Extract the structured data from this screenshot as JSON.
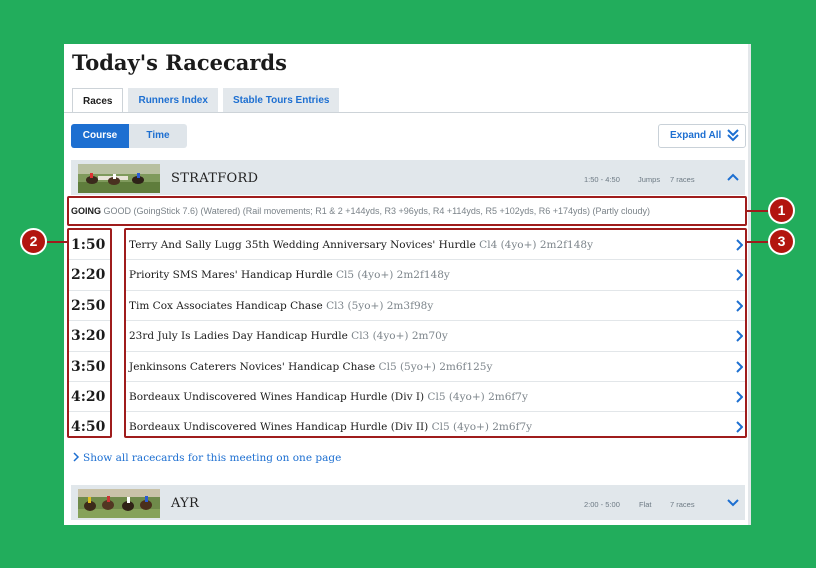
{
  "page": {
    "title": "Today's Racecards",
    "tabs": [
      {
        "label": "Races",
        "active": true
      },
      {
        "label": "Runners Index",
        "active": false
      },
      {
        "label": "Stable Tours Entries",
        "active": false
      }
    ],
    "view_toggle": [
      {
        "label": "Course",
        "active": true
      },
      {
        "label": "Time",
        "active": false
      }
    ],
    "expand_all": "Expand All",
    "show_all_link": "Show all racecards for this meeting on one page"
  },
  "meetings": [
    {
      "name": "STRATFORD",
      "time_range": "1:50 - 4:50",
      "race_type": "Jumps",
      "race_count": "7 races",
      "expanded": true,
      "going_label": "GOING",
      "going_text": "GOOD (GoingStick 7.6) (Watered) (Rail movements; R1 & 2 +144yds, R3 +96yds, R4 +114yds, R5 +102yds, R6 +174yds) (Partly cloudy)",
      "races": [
        {
          "time": "1:50",
          "name": "Terry And Sally Lugg 35th Wedding Anniversary Novices' Hurdle",
          "details": "Cl4 (4yo+) 2m2f148y"
        },
        {
          "time": "2:20",
          "name": "Priority SMS Mares' Handicap Hurdle",
          "details": "Cl5 (4yo+) 2m2f148y"
        },
        {
          "time": "2:50",
          "name": "Tim Cox Associates Handicap Chase",
          "details": "Cl3 (5yo+) 2m3f98y"
        },
        {
          "time": "3:20",
          "name": "23rd July Is Ladies Day Handicap Hurdle",
          "details": "Cl3 (4yo+) 2m70y"
        },
        {
          "time": "3:50",
          "name": "Jenkinsons Caterers Novices' Handicap Chase",
          "details": "Cl5 (5yo+) 2m6f125y"
        },
        {
          "time": "4:20",
          "name": "Bordeaux Undiscovered Wines Handicap Hurdle (Div I)",
          "details": "Cl5 (4yo+) 2m6f7y"
        },
        {
          "time": "4:50",
          "name": "Bordeaux Undiscovered Wines Handicap Hurdle (Div II)",
          "details": "Cl5 (4yo+) 2m6f7y"
        }
      ]
    },
    {
      "name": "AYR",
      "time_range": "2:00 - 5:00",
      "race_type": "Flat",
      "race_count": "7 races",
      "expanded": false
    }
  ],
  "callouts": [
    "1",
    "2",
    "3"
  ],
  "colors": {
    "background": "#22ad5c",
    "link_blue": "#1d6fd1",
    "highlight_red": "#9f1c1c",
    "callout_red": "#b2150f"
  }
}
